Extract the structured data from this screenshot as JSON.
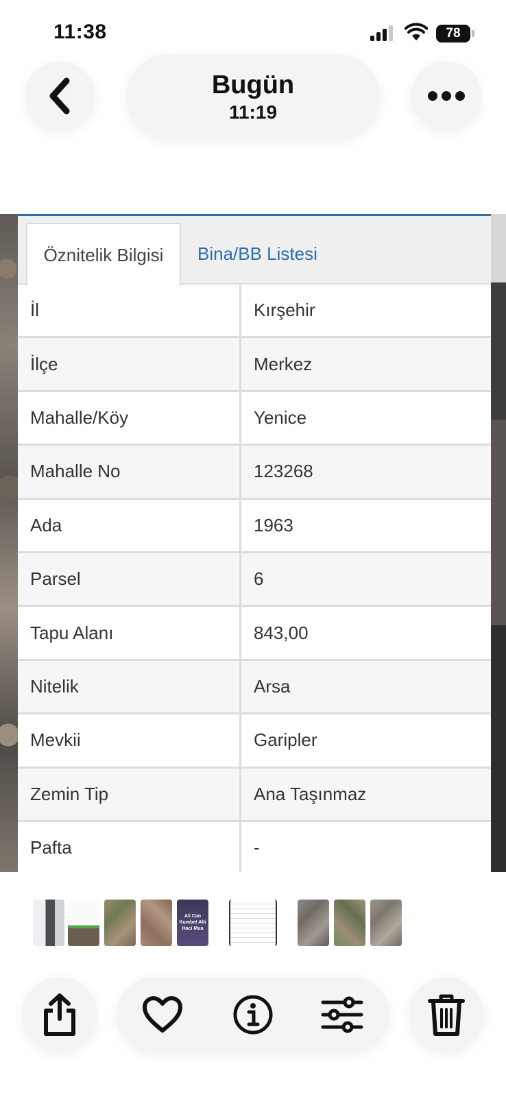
{
  "status_bar": {
    "time": "11:38",
    "battery": "78"
  },
  "header": {
    "title": "Bugün",
    "subtitle": "11:19"
  },
  "panel": {
    "tabs": [
      {
        "label": "Öznitelik Bilgisi",
        "active": true
      },
      {
        "label": "Bina/BB Listesi",
        "active": false
      }
    ],
    "rows": [
      {
        "label": "İl",
        "value": "Kırşehir"
      },
      {
        "label": "İlçe",
        "value": "Merkez"
      },
      {
        "label": "Mahalle/Köy",
        "value": "Yenice"
      },
      {
        "label": "Mahalle No",
        "value": "123268"
      },
      {
        "label": "Ada",
        "value": "1963"
      },
      {
        "label": "Parsel",
        "value": "6"
      },
      {
        "label": "Tapu Alanı",
        "value": "843,00"
      },
      {
        "label": "Nitelik",
        "value": "Arsa"
      },
      {
        "label": "Mevkii",
        "value": "Garipler"
      },
      {
        "label": "Zemin Tip",
        "value": "Ana Taşınmaz"
      },
      {
        "label": "Pafta",
        "value": "-"
      }
    ]
  },
  "thumbnails": {
    "contact_card_text": "Ali Can Kumbet Alti Haci Mua"
  },
  "colors": {
    "accent_blue": "#2e6fa8",
    "panel_border": "#2f6ea8"
  },
  "icons": [
    "chevron-left-icon",
    "more-horizontal-icon",
    "share-icon",
    "heart-icon",
    "info-icon",
    "sliders-icon",
    "trash-icon"
  ]
}
